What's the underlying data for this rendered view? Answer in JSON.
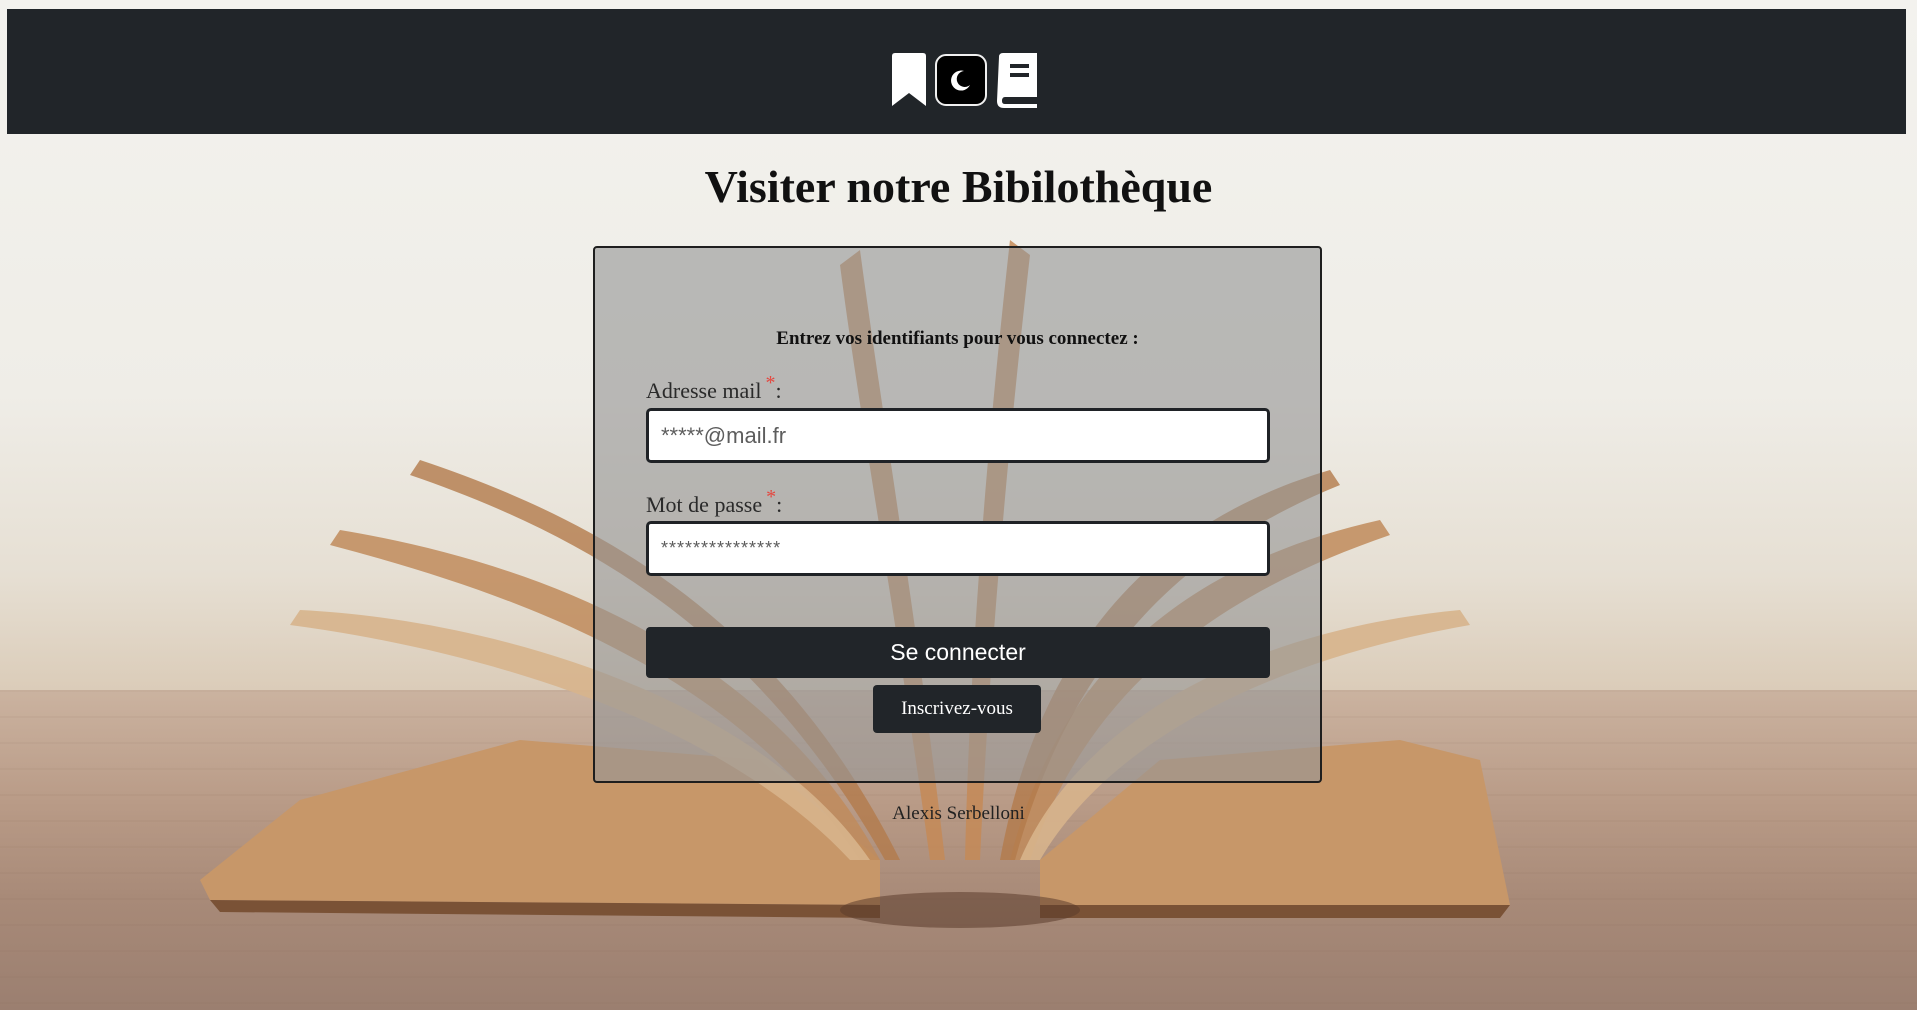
{
  "page": {
    "title": "Visiter notre Bibilothèque"
  },
  "header": {
    "icons": [
      "bookmark-icon",
      "moon-icon",
      "book-icon"
    ],
    "background_color": "#212529"
  },
  "login": {
    "instructions": "Entrez vos identifiants pour vous connectez :",
    "email_label": "Adresse mail",
    "email_placeholder": "*****@mail.fr",
    "password_label": "Mot de passe",
    "password_placeholder": "***************",
    "required_marker": "*",
    "label_suffix": ":",
    "submit_label": "Se connecter",
    "register_label": "Inscrivez-vous"
  },
  "footer": {
    "author": "Alexis Serbelloni"
  },
  "colors": {
    "dark": "#212529",
    "required": "#e4473f"
  }
}
